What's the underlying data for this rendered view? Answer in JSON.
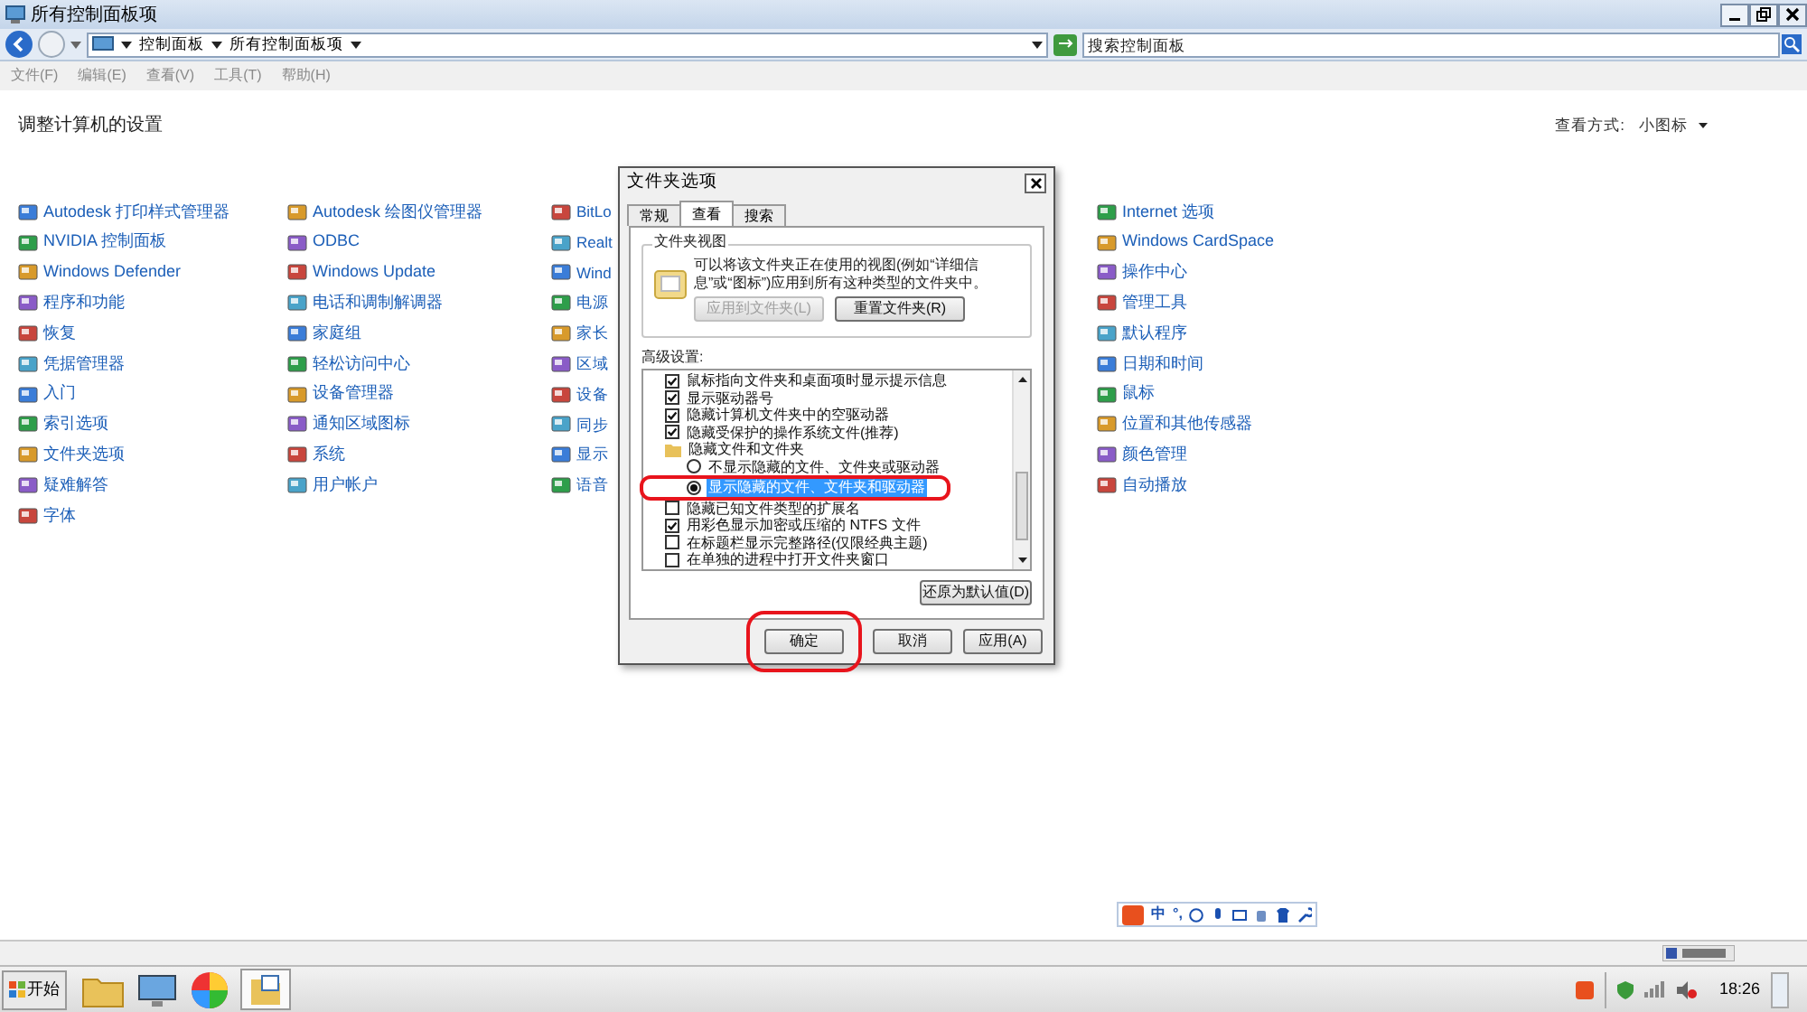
{
  "window": {
    "title": "所有控制面板项"
  },
  "address": {
    "crumbs": [
      "控制面板",
      "所有控制面板项"
    ],
    "search_placeholder": "搜索控制面板"
  },
  "menu": [
    "文件(F)",
    "编辑(E)",
    "查看(V)",
    "工具(T)",
    "帮助(H)"
  ],
  "heading": "调整计算机的设置",
  "view_by": {
    "label": "查看方式:",
    "value": "小图标"
  },
  "columns": [
    [
      "Autodesk 打印样式管理器",
      "NVIDIA 控制面板",
      "Windows Defender",
      "程序和功能",
      "恢复",
      "凭据管理器",
      "入门",
      "索引选项",
      "文件夹选项",
      "疑难解答",
      "字体"
    ],
    [
      "Autodesk 绘图仪管理器",
      "ODBC",
      "Windows Update",
      "电话和调制解调器",
      "家庭组",
      "轻松访问中心",
      "设备管理器",
      "通知区域图标",
      "系统",
      "用户帐户"
    ],
    [
      "BitLo",
      "Realt",
      "Wind",
      "电源",
      "家长",
      "区域",
      "设备",
      "同步",
      "显示",
      "语音"
    ],
    [
      "Internet 选项",
      "Windows CardSpace",
      "操作中心",
      "管理工具",
      "默认程序",
      "日期和时间",
      "鼠标",
      "位置和其他传感器",
      "颜色管理",
      "自动播放"
    ]
  ],
  "dialog": {
    "title": "文件夹选项",
    "tabs": [
      {
        "label": "常规",
        "selected": false
      },
      {
        "label": "查看",
        "selected": true
      },
      {
        "label": "搜索",
        "selected": false
      }
    ],
    "group_title": "文件夹视图",
    "group_text": "可以将该文件夹正在使用的视图(例如“详细信息”或“图标”)应用到所有这种类型的文件夹中。",
    "group_buttons": [
      {
        "label": "应用到文件夹(L)",
        "disabled": true
      },
      {
        "label": "重置文件夹(R)",
        "disabled": false
      }
    ],
    "advanced_label": "高级设置:",
    "settings": [
      {
        "kind": "checkbox",
        "label": "鼠标指向文件夹和桌面项时显示提示信息",
        "checked": true,
        "selected": false
      },
      {
        "kind": "checkbox",
        "label": "显示驱动器号",
        "checked": true,
        "selected": false
      },
      {
        "kind": "checkbox",
        "label": "隐藏计算机文件夹中的空驱动器",
        "checked": true,
        "selected": false
      },
      {
        "kind": "checkbox",
        "label": "隐藏受保护的操作系统文件(推荐)",
        "checked": true,
        "selected": false
      },
      {
        "kind": "folder",
        "label": "隐藏文件和文件夹"
      },
      {
        "kind": "radio",
        "label": "不显示隐藏的文件、文件夹或驱动器",
        "checked": false,
        "selected": false
      },
      {
        "kind": "radio",
        "label": "显示隐藏的文件、文件夹和驱动器",
        "checked": true,
        "selected": true,
        "circled": true
      },
      {
        "kind": "checkbox",
        "label": "隐藏已知文件类型的扩展名",
        "checked": false,
        "selected": false
      },
      {
        "kind": "checkbox",
        "label": "用彩色显示加密或压缩的 NTFS 文件",
        "checked": true,
        "selected": false
      },
      {
        "kind": "checkbox",
        "label": "在标题栏显示完整路径(仅限经典主题)",
        "checked": false,
        "selected": false
      },
      {
        "kind": "checkbox",
        "label": "在单独的进程中打开文件夹窗口",
        "checked": false,
        "selected": false
      }
    ],
    "restore_button": "还原为默认值(D)",
    "buttons": [
      {
        "label": "确定",
        "circled": true
      },
      {
        "label": "取消",
        "circled": false
      },
      {
        "label": "应用(A)",
        "circled": false
      }
    ]
  },
  "ime_toolbar": [
    "中",
    "°,"
  ],
  "taskbar": {
    "start": "开始",
    "clock": "18:26"
  }
}
